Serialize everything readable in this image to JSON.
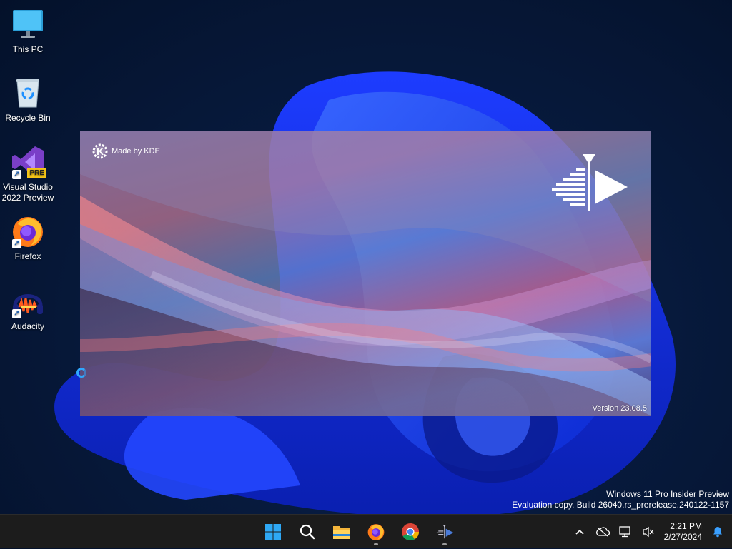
{
  "desktop": {
    "icons": [
      {
        "label": "This PC",
        "icon": "monitor-icon"
      },
      {
        "label": "Recycle Bin",
        "icon": "recycle-bin-icon"
      },
      {
        "label": "Visual Studio\n2022 Preview",
        "label_line1": "Visual Studio",
        "label_line2": "2022 Preview",
        "icon": "visual-studio-icon",
        "badge": "PRE"
      },
      {
        "label": "Firefox",
        "icon": "firefox-icon"
      },
      {
        "label": "Audacity",
        "icon": "audacity-icon"
      }
    ]
  },
  "splash": {
    "made_by": "Made by KDE",
    "kde_logo_letter": "K",
    "version": "Version 23.08.5",
    "app_logo": "kdenlive-icon"
  },
  "watermark": {
    "line1": "Windows 11 Pro Insider Preview",
    "line2": "Evaluation copy. Build 26040.rs_prerelease.240122-1157"
  },
  "taskbar": {
    "apps": [
      {
        "name": "start-button",
        "icon": "windows-logo-icon",
        "running": false
      },
      {
        "name": "search-button",
        "icon": "search-icon",
        "running": false
      },
      {
        "name": "file-explorer",
        "icon": "folder-icon",
        "running": false
      },
      {
        "name": "firefox",
        "icon": "firefox-icon",
        "running": true
      },
      {
        "name": "chrome",
        "icon": "chrome-icon",
        "running": false
      },
      {
        "name": "kdenlive",
        "icon": "kdenlive-icon",
        "running": true
      }
    ],
    "tray": {
      "chevron": "chevron-up-icon",
      "onedrive": "cloud-offline-icon",
      "network": "network-icon",
      "volume": "volume-muted-icon",
      "notifications": "bell-icon"
    },
    "clock": {
      "time": "2:21 PM",
      "date": "2/27/2024"
    }
  },
  "colors": {
    "taskbar_bg": "#1c1c1c",
    "busy_ring": "#2fa8ff",
    "wallpaper_blue": "#1f4fff"
  }
}
